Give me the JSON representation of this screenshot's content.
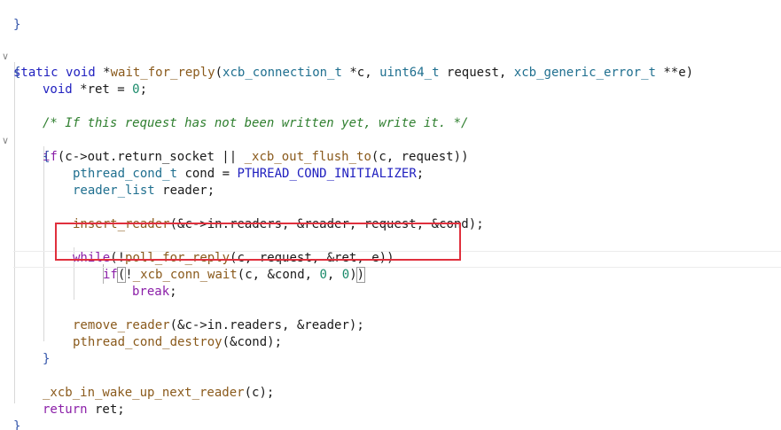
{
  "editor": {
    "language": "C",
    "lines": {
      "l01": "}",
      "l02": "static void *wait_for_reply(xcb_connection_t *c, uint64_t request, xcb_generic_error_t **e)",
      "l03": "{",
      "l04": "void *ret = 0;",
      "l06": "/* If this request has not been written yet, write it. */",
      "l07": "if(c->out.return_socket || _xcb_out_flush_to(c, request))",
      "l08": "{",
      "l09": "pthread_cond_t cond = PTHREAD_COND_INITIALIZER;",
      "l10": "reader_list reader;",
      "l12": "insert_reader(&c->in.readers, &reader, request, &cond);",
      "l14": "while(!poll_for_reply(c, request, &ret, e))",
      "l15": "if(!_xcb_conn_wait(c, &cond, 0, 0))",
      "l16": "break;",
      "l18": "remove_reader(&c->in.readers, &reader);",
      "l19": "pthread_cond_destroy(&cond);",
      "l20": "}",
      "l22": "_xcb_in_wake_up_next_reader(c);",
      "l23": "return ret;",
      "l24": "}"
    },
    "tokens": {
      "static": "static",
      "void": "void",
      "star": " *",
      "fn_wait": "wait_for_reply",
      "lp": "(",
      "rp": ")",
      "t_conn": "xcb_connection_t",
      "p_c": " *c, ",
      "t_u64": "uint64_t",
      "p_req": " request, ",
      "t_err": "xcb_generic_error_t",
      "p_e": " **e",
      "ret_decl": " *ret = ",
      "zero": "0",
      "semi": ";",
      "kw_if": "if",
      "c_out": "c->out.return_socket || ",
      "fn_flush": "_xcb_out_flush_to",
      "args_c_req": "c, request",
      "t_cond": "pthread_cond_t",
      "cond_eq": " cond = ",
      "m_init": "PTHREAD_COND_INITIALIZER",
      "t_rl": "reader_list",
      "reader_semi": " reader;",
      "fn_insert": "insert_reader",
      "insert_args": "&c->in.readers, &reader, request, &cond",
      "kw_while": "while",
      "bang": "!",
      "fn_poll": "poll_for_reply",
      "poll_args": "c, request, &ret, e",
      "fn_wait2": "_xcb_conn_wait",
      "wait_args_a": "c, &cond, ",
      "comma": ", ",
      "kw_break": "break",
      "fn_remove": "remove_reader",
      "remove_args": "&c->in.readers, &reader",
      "fn_destroy": "pthread_cond_destroy",
      "destroy_args": "&cond",
      "fn_wake": "_xcb_in_wake_up_next_reader",
      "arg_c": "c",
      "kw_return": "return",
      "ret_semi": " ret;"
    },
    "fold_markers": {
      "fold_fn": "∨",
      "fold_if": "∨"
    },
    "annotation": {
      "highlight_color": "#e0303d"
    }
  }
}
